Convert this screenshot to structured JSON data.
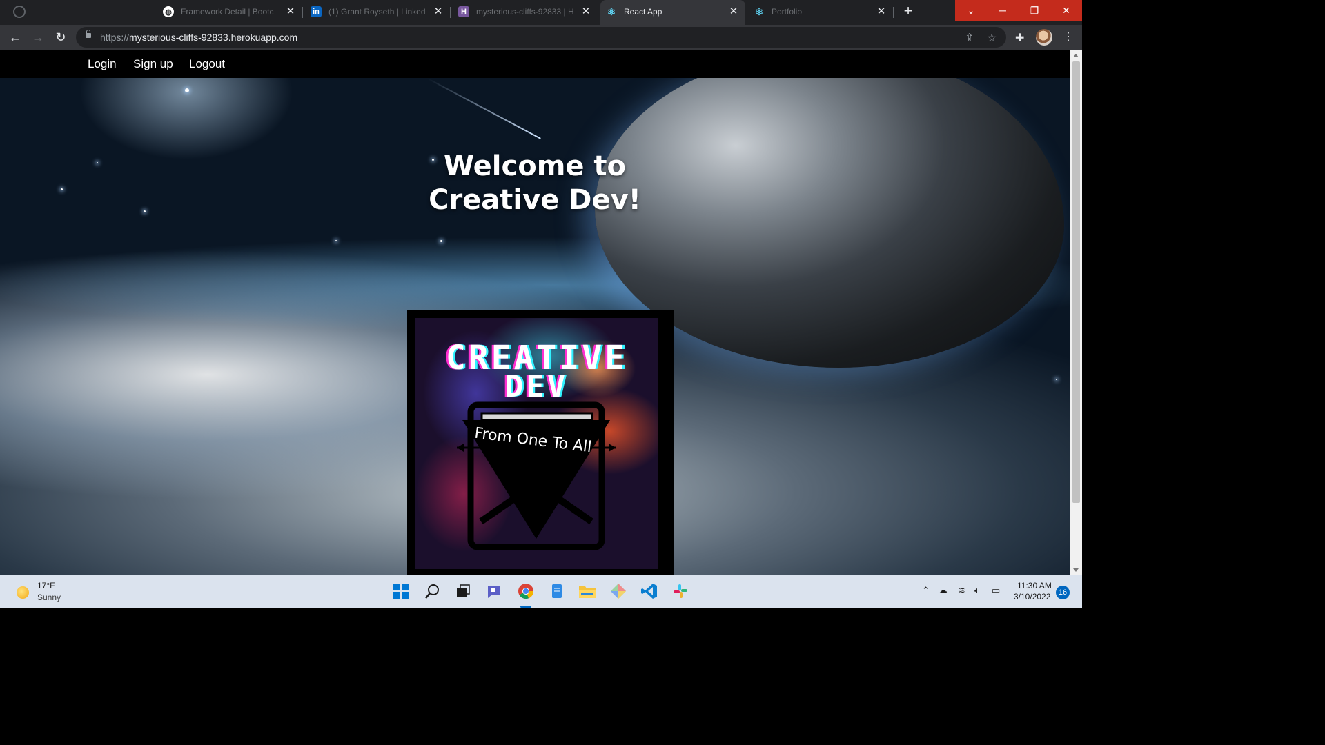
{
  "browser": {
    "tabs": [
      {
        "title": "Framework Detail | Bootc",
        "icon": "globe-icon"
      },
      {
        "title": "(1) Grant Royseth | LinkedIn",
        "icon": "linkedin-icon"
      },
      {
        "title": "mysterious-cliffs-92833 | H",
        "icon": "heroku-icon"
      },
      {
        "title": "React App",
        "icon": "react-icon",
        "active": true
      },
      {
        "title": "Portfolio",
        "icon": "react-icon"
      }
    ],
    "url_scheme": "https://",
    "url_host": "mysterious-cliffs-92833.herokuapp.com",
    "new_tab_label": "+"
  },
  "site": {
    "nav": {
      "login": "Login",
      "signup": "Sign up",
      "logout": "Logout"
    },
    "hero_line1": "Welcome to",
    "hero_line2": "Creative Dev!",
    "logo": {
      "line1": "CREATIVE",
      "line2": "DEV",
      "tagline": "From One To All"
    }
  },
  "taskbar": {
    "weather_temp": "17°F",
    "weather_condition": "Sunny",
    "time": "11:30 AM",
    "date": "3/10/2022",
    "notification_count": "16"
  },
  "colors": {
    "accent": "#0067c0",
    "close_red": "#c42b1c",
    "linkedin": "#0a66c2",
    "heroku": "#79589f"
  }
}
